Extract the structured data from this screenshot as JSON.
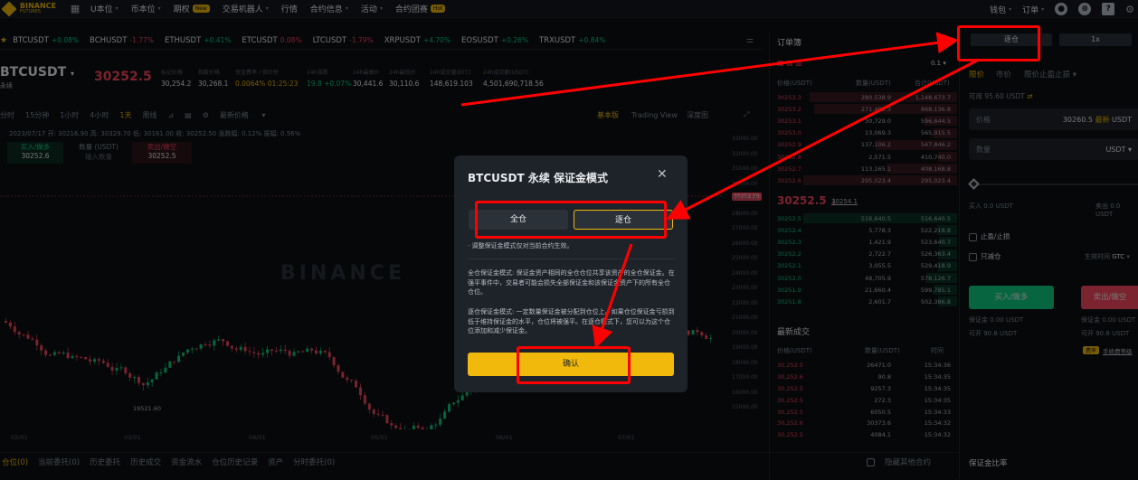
{
  "nav": {
    "brand": "BINANCE",
    "brand_sub": "FUTURES",
    "items": [
      {
        "label": "U本位",
        "caret": "▾"
      },
      {
        "label": "币本位",
        "caret": "▾"
      },
      {
        "label": "期权",
        "badge": "New"
      },
      {
        "label": "交易机器人",
        "caret": "▾"
      },
      {
        "label": "行情"
      },
      {
        "label": "合约信息",
        "caret": "▾"
      },
      {
        "label": "活动",
        "caret": "▾"
      },
      {
        "label": "合约团赛",
        "badge": "Hot"
      }
    ],
    "right": [
      "钱包",
      "订单"
    ]
  },
  "tickers": [
    {
      "sym": "BTCUSDT",
      "chg": "+0.08%",
      "dir": "up"
    },
    {
      "sym": "BCHUSDT",
      "chg": "-1.77%",
      "dir": "dn"
    },
    {
      "sym": "ETHUSDT",
      "chg": "+0.41%",
      "dir": "up"
    },
    {
      "sym": "ETCUSDT",
      "chg": "0.08%",
      "dir": "dn"
    },
    {
      "sym": "LTCUSDT",
      "chg": "-1.79%",
      "dir": "dn"
    },
    {
      "sym": "XRPUSDT",
      "chg": "+4.70%",
      "dir": "up"
    },
    {
      "sym": "EOSUSDT",
      "chg": "+0.26%",
      "dir": "up"
    },
    {
      "sym": "TRXUSDT",
      "chg": "+0.84%",
      "dir": "up"
    }
  ],
  "symbol": {
    "name": "BTCUSDT",
    "sub": "永续",
    "last": "30252.5",
    "stats": [
      {
        "label": "标记价格",
        "value": "30,254.2"
      },
      {
        "label": "指数价格",
        "value": "30,268.1"
      },
      {
        "label": "资金费率 / 倒计时",
        "value": "0.0064%  01:25:23"
      },
      {
        "label": "24h涨跌",
        "value": "19.8 +0.07%"
      },
      {
        "label": "24h最高价",
        "value": "30,441.6"
      },
      {
        "label": "24h最低价",
        "value": "30,110.6"
      },
      {
        "label": "24h成交量(BTC)",
        "value": "148,619.103"
      },
      {
        "label": "24h成交额(USDT)",
        "value": "4,501,690,718.56"
      }
    ]
  },
  "timeframes": [
    "分时",
    "15分钟",
    "1小时",
    "4小时",
    "1天",
    "周线"
  ],
  "chart_tools": {
    "indicator": "最新价格",
    "views": [
      "基本版",
      "Trading View",
      "深度图"
    ]
  },
  "ohlc": "2023/07/17  开: 30216.90  高: 30329.70  低: 30161.00  收: 30252.50  涨跌幅: 0.12%  振幅: 0.56%",
  "quick": {
    "buy_label": "买入/做多",
    "buy_value": "30252.6",
    "qty_label": "数量 (USDT)",
    "qty_placeholder": "输入数量",
    "sell_label": "卖出/做空",
    "sell_value": "30252.5"
  },
  "chart_low_label": "19521.60",
  "chart_price_tag": "30252.50",
  "watermark": "BINANCE",
  "y_ticks": [
    "33000.00",
    "32000.00",
    "31000.00",
    "30000.00",
    "29000.00",
    "28000.00",
    "27000.00",
    "26000.00",
    "25000.00",
    "24000.00",
    "23000.00",
    "22000.00",
    "21000.00",
    "20000.00",
    "19000.00",
    "18000.00",
    "17000.00",
    "16000.00",
    "15000.00"
  ],
  "x_ticks": [
    "02/01",
    "03/01",
    "04/01",
    "05/01",
    "06/01",
    "07/01"
  ],
  "bottom_tabs": [
    "仓位(0)",
    "当前委托(0)",
    "历史委托",
    "历史成交",
    "资金流水",
    "仓位历史记录",
    "资产",
    "分时委托(0)"
  ],
  "orderbook": {
    "title": "订单簿",
    "precision": "0.1",
    "headers": [
      "价格(USDT)",
      "数量(USDT)",
      "合计(USDT)"
    ],
    "asks": [
      [
        "30253.3",
        "280,538.9",
        "1,148,673.7"
      ],
      [
        "30253.2",
        "271,492.3",
        "868,136.8"
      ],
      [
        "30253.1",
        "30,729.0",
        "596,644.5"
      ],
      [
        "30253.0",
        "13,069.3",
        "565,915.5"
      ],
      [
        "30252.9",
        "137,106.2",
        "547,846.2"
      ],
      [
        "30252.8",
        "2,571.5",
        "410,740.0"
      ],
      [
        "30252.7",
        "113,165.1",
        "408,168.8"
      ],
      [
        "30252.6",
        "295,023.4",
        "295,023.4"
      ]
    ],
    "mid": "30252.5",
    "mid_arrow": "↓",
    "mark": "30254.1",
    "bids": [
      [
        "30252.5",
        "516,640.5",
        "516,640.5"
      ],
      [
        "30252.4",
        "5,778.3",
        "522,218.8"
      ],
      [
        "30252.3",
        "1,421.9",
        "523,640.7"
      ],
      [
        "30252.2",
        "2,722.7",
        "526,363.4"
      ],
      [
        "30252.1",
        "3,055.5",
        "529,418.9"
      ],
      [
        "30252.0",
        "48,705.9",
        "578,126.7"
      ],
      [
        "30251.9",
        "21,660.4",
        "599,785.1"
      ],
      [
        "30251.8",
        "2,601.7",
        "502,386.8"
      ]
    ]
  },
  "trades": {
    "title": "最新成交",
    "headers": [
      "价格(USDT)",
      "数量(USDT)",
      "时间"
    ],
    "rows": [
      [
        "30,252.5",
        "26471.0",
        "15:34:36"
      ],
      [
        "30,252.6",
        "90.8",
        "15:34:35"
      ],
      [
        "30,252.5",
        "9257.3",
        "15:34:35"
      ],
      [
        "30,252.5",
        "272.3",
        "15:34:35"
      ],
      [
        "30,252.5",
        "6050.5",
        "15:34:33"
      ],
      [
        "30,252.6",
        "30373.6",
        "15:34:32"
      ],
      [
        "30,252.5",
        "4084.1",
        "15:34:32"
      ]
    ]
  },
  "form": {
    "margin_mode": "逐仓",
    "leverage": "1x",
    "order_types": [
      "限价",
      "市价",
      "限价止盈止损"
    ],
    "available": "可用 95.60 USDT",
    "price_label": "价格",
    "price_value": "30260.5",
    "price_suffix": "最新",
    "price_unit": "USDT",
    "qty_label": "数量",
    "qty_unit": "USDT",
    "buy_amount": "买入 0.0 USDT",
    "sell_amount": "卖出 0.0 USDT",
    "tpsl": "止盈/止损",
    "reduce_only": "只减仓",
    "tif_label": "生效时间",
    "tif_value": "GTC",
    "buy_btn": "买入/做多",
    "sell_btn": "卖出/做空",
    "margin_buy": "保证金 0.00 USDT",
    "margin_sell": "保证金 0.00 USDT",
    "max_buy": "可开 90.8 USDT",
    "max_sell": "可开 90.8 USDT",
    "fee_badge": "费率",
    "fee_link": "手续费等级",
    "ratio_title": "保证金比率",
    "hide_other": "隐藏其他合约"
  },
  "modal": {
    "title": "BTCUSDT 永续 保证金模式",
    "close": "✕",
    "cross": "全仓",
    "isolated": "逐仓",
    "note1": "· 调整保证金模式仅对当前合约生效。",
    "note2": "全仓保证金模式: 保证金资产相同的全仓仓位共享该资产的全仓保证金。在强平事件中，交易者可能会损失全部保证金和该保证金资产下的所有全仓仓位。",
    "note3": "逐仓保证金模式: 一定数量保证金被分配到仓位上。如果仓位保证金亏损到低于维持保证金的水平，仓位将被强平。在逐仓模式下，您可以为这个仓位添加和减少保证金。",
    "confirm": "确认"
  },
  "colors": {
    "accent": "#f0b90b",
    "buy": "#0ecb81",
    "sell": "#f6465d",
    "annotation": "#ff0000"
  }
}
